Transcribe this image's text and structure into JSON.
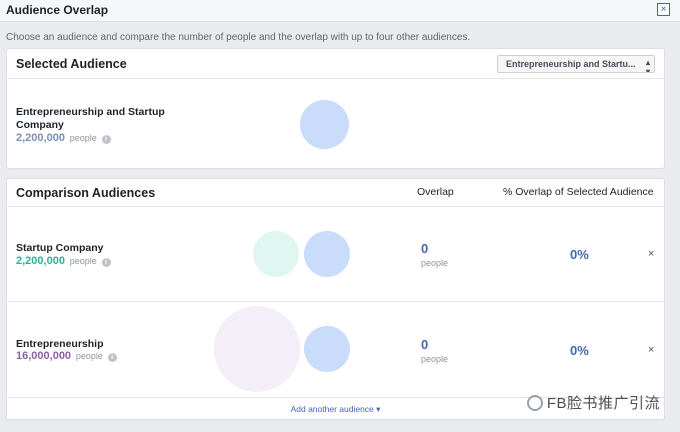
{
  "window": {
    "title": "Audience Overlap",
    "close_symbol": "×"
  },
  "subtitle": "Choose an audience and compare the number of people and the overlap with up to four other audiences.",
  "selected": {
    "title": "Selected Audience",
    "dropdown_value": "Entrepreneurship and Startu...",
    "audience": {
      "name_line1": "Entrepreneurship and Startup",
      "name_line2": "Company",
      "count": "2,200,000",
      "unit": "people"
    }
  },
  "comparison": {
    "title": "Comparison Audiences",
    "overlap_header": "Overlap",
    "pct_header": "% Overlap of Selected Audience",
    "rows": [
      {
        "name": "Startup Company",
        "count": "2,200,000",
        "unit": "people",
        "overlap": "0",
        "overlap_unit": "people",
        "pct": "0%",
        "remove": "×"
      },
      {
        "name": "Entrepreneurship",
        "count": "16,000,000",
        "unit": "people",
        "overlap": "0",
        "overlap_unit": "people",
        "pct": "0%",
        "remove": "×"
      }
    ],
    "add_link": "Add another audience ▾"
  },
  "watermark": "FB脸书推广引流",
  "colors": {
    "accent": "#4267b2",
    "selected_count": "#7c8fb6",
    "row1_count": "#27b58f",
    "row2_count": "#8c5fa6",
    "circle_selected": "#c9dcfa",
    "circle_row1": "#dff7f0",
    "circle_row2": "#f3eef8"
  },
  "icons": {
    "info": "info-icon",
    "close": "close-icon",
    "dropdown": "caret-icon"
  }
}
